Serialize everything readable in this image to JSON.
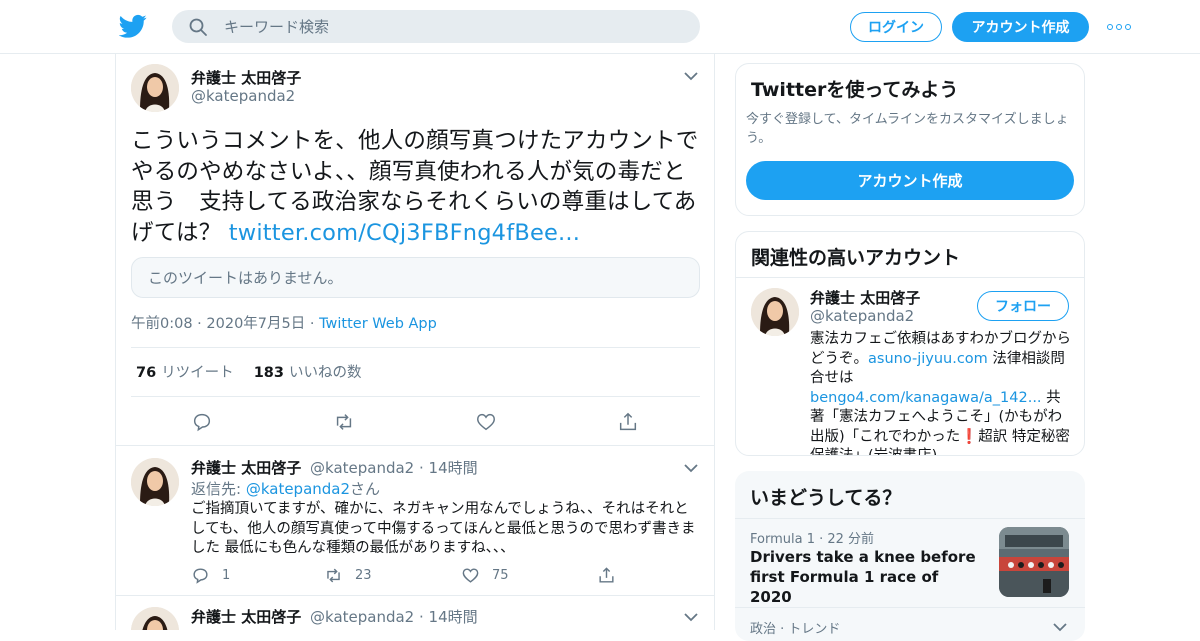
{
  "header": {
    "search_placeholder": "キーワード検索",
    "login_label": "ログイン",
    "signup_label": "アカウント作成"
  },
  "focal_tweet": {
    "name": "弁護士 太田啓子",
    "handle": "@katepanda2",
    "text": "こういうコメントを、他人の顔写真つけたアカウントでやるのやめなさいよ、、顔写真使われる人が気の毒だと思う　支持してる政治家ならそれくらいの尊重はしてあげては？ ",
    "link": "twitter.com/CQj3FBFng4fBee...",
    "unavailable": "このツイートはありません。",
    "time": "午前0:08",
    "date": "2020年7月5日",
    "source": "Twitter Web App",
    "retweets_count": "76",
    "retweets_label": "リツイート",
    "likes_count": "183",
    "likes_label": "いいねの数"
  },
  "replies": [
    {
      "name": "弁護士 太田啓子",
      "handle": "@katepanda2",
      "time": "14時間",
      "reply_to_label": "返信先: ",
      "reply_to_handle": "@katepanda2",
      "reply_to_suffix": "さん",
      "text": "ご指摘頂いてますが、確かに、ネガキャン用なんでしょうね、、それはそれとしても、他人の顔写真使って中傷するってほんと最低と思うので思わず書きました 最低にも色んな種類の最低がありますね、、、",
      "replies": "1",
      "retweets": "23",
      "likes": "75"
    },
    {
      "name": "弁護士 太田啓子",
      "handle": "@katepanda2",
      "time": "14時間"
    }
  ],
  "sidebar": {
    "try_title": "Twitterを使ってみよう",
    "try_desc": "今すぐ登録して、タイムラインをカスタマイズしましょう。",
    "try_button": "アカウント作成",
    "related_title": "関連性の高いアカウント",
    "related": {
      "name": "弁護士 太田啓子",
      "handle": "@katepanda2",
      "follow_label": "フォロー",
      "bio_1": "憲法カフェご依頼はあすわかブログからどうぞ。",
      "bio_link1": "asuno-jiyuu.com",
      "bio_2": " 法律相談問合せは",
      "bio_link2": "bengo4.com/kanagawa/a_142...",
      "bio_3": " 共著「憲法カフェへようこそ」(かもがわ出版)「これでわかった",
      "bio_emoji": "❗",
      "bio_4": "超訳 特定秘密保護法」(岩波書店)。"
    },
    "trends_title": "いまどうしてる？",
    "trend1_category": "Formula 1",
    "trend1_time": "22 分前",
    "trend1_title": "Drivers take a knee before first Formula 1 race of 2020",
    "trend2_category": "政治 · トレンド"
  },
  "colors": {
    "brand": "#1da1f2",
    "link": "#1b95e0",
    "muted": "#657786",
    "border": "#e6ecf0"
  }
}
